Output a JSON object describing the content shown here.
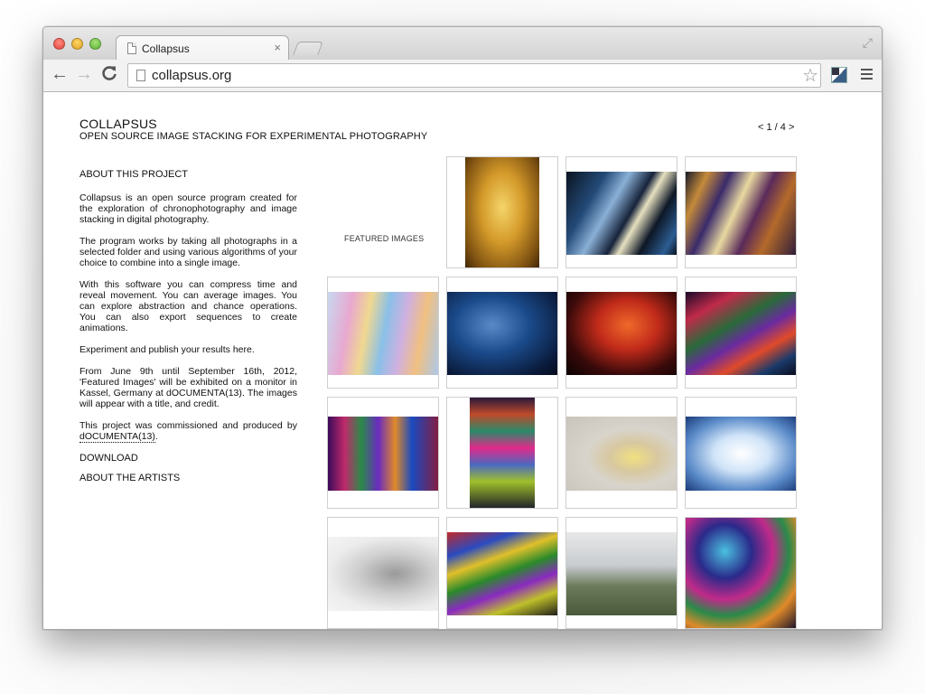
{
  "browser": {
    "tab_title": "Collapsus",
    "tab_close": "×",
    "url": "collapsus.org",
    "back": "←",
    "forward": "→",
    "reload": "C",
    "star": "☆",
    "fullscreen": "⤢"
  },
  "header": {
    "title": "COLLAPSUS",
    "subtitle": "OPEN SOURCE IMAGE STACKING FOR EXPERIMENTAL PHOTOGRAPHY"
  },
  "pager": {
    "prev": "<",
    "label": "1 / 4",
    "next": ">"
  },
  "about": {
    "heading": "ABOUT THIS PROJECT",
    "p1": "Collapsus is an open source program created for the exploration of chronophotography and image stacking in digital photography.",
    "p2": "The program works by taking all photographs in a selected folder and using various algorithms of your choice to combine into a single image.",
    "p3": "With this software you can compress time and reveal movement. You can average images. You can explore abstraction and chance operations. You can also export sequences to create animations.",
    "p4": "Experiment and publish your results here.",
    "p5": "From June 9th until September 16th, 2012, 'Featured Images' will be exhibited on a monitor in Kassel, Germany at dOCUMENTA(13). The images will appear with a title, and credit.",
    "p6_prefix": "This project was commissioned and produced by",
    "p6_link": "dOCUMENTA(13)",
    "p6_suffix": ".",
    "download": "DOWNLOAD",
    "artists": "ABOUT THE ARTISTS"
  },
  "gallery": {
    "featured_label": "FEATURED IMAGES"
  }
}
